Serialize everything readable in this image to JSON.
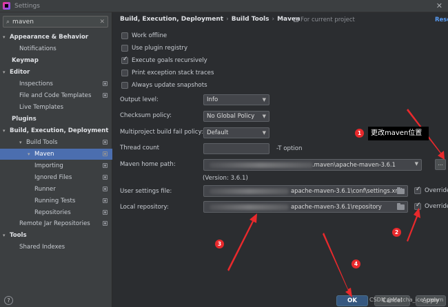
{
  "window": {
    "title": "Settings"
  },
  "search": {
    "value": "maven"
  },
  "tree": [
    {
      "label": "Appearance & Behavior",
      "bold": true,
      "arrow": "▾",
      "indent": 0,
      "proj": false
    },
    {
      "label": "Notifications",
      "bold": false,
      "arrow": "",
      "indent": 1,
      "proj": false
    },
    {
      "label": "Keymap",
      "bold": true,
      "arrow": "",
      "indent": 0,
      "proj": false
    },
    {
      "label": "Editor",
      "bold": true,
      "arrow": "▾",
      "indent": 0,
      "proj": false
    },
    {
      "label": "Inspections",
      "bold": false,
      "arrow": "",
      "indent": 1,
      "proj": true
    },
    {
      "label": "File and Code Templates",
      "bold": false,
      "arrow": "",
      "indent": 1,
      "proj": true
    },
    {
      "label": "Live Templates",
      "bold": false,
      "arrow": "",
      "indent": 1,
      "proj": false
    },
    {
      "label": "Plugins",
      "bold": true,
      "arrow": "",
      "indent": 0,
      "proj": false
    },
    {
      "label": "Build, Execution, Deployment",
      "bold": true,
      "arrow": "▾",
      "indent": 0,
      "proj": false
    },
    {
      "label": "Build Tools",
      "bold": false,
      "arrow": "▾",
      "indent": 1,
      "proj": true
    },
    {
      "label": "Maven",
      "bold": false,
      "arrow": "▾",
      "indent": 2,
      "proj": true,
      "selected": true
    },
    {
      "label": "Importing",
      "bold": false,
      "arrow": "",
      "indent": 3,
      "proj": true
    },
    {
      "label": "Ignored Files",
      "bold": false,
      "arrow": "",
      "indent": 3,
      "proj": true
    },
    {
      "label": "Runner",
      "bold": false,
      "arrow": "",
      "indent": 3,
      "proj": true
    },
    {
      "label": "Running Tests",
      "bold": false,
      "arrow": "",
      "indent": 3,
      "proj": true
    },
    {
      "label": "Repositories",
      "bold": false,
      "arrow": "",
      "indent": 3,
      "proj": true
    },
    {
      "label": "Remote Jar Repositories",
      "bold": false,
      "arrow": "",
      "indent": 1,
      "proj": true
    },
    {
      "label": "Tools",
      "bold": true,
      "arrow": "▾",
      "indent": 0,
      "proj": false
    },
    {
      "label": "Shared Indexes",
      "bold": false,
      "arrow": "",
      "indent": 1,
      "proj": false
    }
  ],
  "breadcrumb": {
    "part1": "Build, Execution, Deployment",
    "part2": "Build Tools",
    "part3": "Maven",
    "sep": "›"
  },
  "for_project": "For current project",
  "reset": "Rese",
  "checkboxes": [
    {
      "label": "Work offline",
      "checked": false
    },
    {
      "label": "Use plugin registry",
      "checked": false
    },
    {
      "label": "Execute goals recursively",
      "checked": true
    },
    {
      "label": "Print exception stack traces",
      "checked": false
    },
    {
      "label": "Always update snapshots",
      "checked": false
    }
  ],
  "fields": {
    "output_level": {
      "label": "Output level:",
      "value": "Info"
    },
    "checksum_policy": {
      "label": "Checksum policy:",
      "value": "No Global Policy"
    },
    "multiproject_policy": {
      "label": "Multiproject build fail policy:",
      "value": "Default"
    },
    "thread_count": {
      "label": "Thread count",
      "hint": "-T option"
    },
    "maven_home": {
      "label": "Maven home path:",
      "value": ".maven\\apache-maven-3.6.1",
      "version": "(Version: 3.6.1)"
    },
    "user_settings": {
      "label": "User settings file:",
      "value": "apache-maven-3.6.1\\conf\\settings.xml",
      "override": "Override"
    },
    "local_repo": {
      "label": "Local repository:",
      "value": "apache-maven-3.6.1\\repository",
      "override": "Override"
    }
  },
  "buttons": {
    "ok": "OK",
    "cancel": "Cancel",
    "apply": "Apply",
    "help": "?",
    "browse": "..."
  },
  "annotations": {
    "tip": "更改maven位置",
    "badges": [
      "1",
      "2",
      "3",
      "4"
    ],
    "color": "#e8292c"
  },
  "watermark": "CSDN @Matcha_ice_cream"
}
